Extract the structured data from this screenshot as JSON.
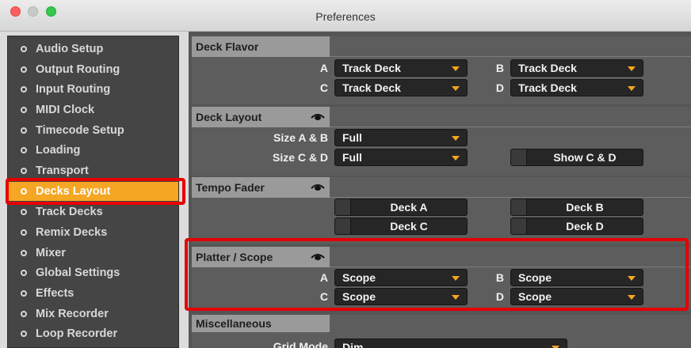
{
  "window": {
    "title": "Preferences"
  },
  "sidebar": {
    "items": [
      {
        "label": "Audio Setup"
      },
      {
        "label": "Output Routing"
      },
      {
        "label": "Input Routing"
      },
      {
        "label": "MIDI Clock"
      },
      {
        "label": "Timecode Setup"
      },
      {
        "label": "Loading"
      },
      {
        "label": "Transport"
      },
      {
        "label": "Decks Layout",
        "selected": true
      },
      {
        "label": "Track Decks"
      },
      {
        "label": "Remix Decks"
      },
      {
        "label": "Mixer"
      },
      {
        "label": "Global Settings"
      },
      {
        "label": "Effects"
      },
      {
        "label": "Mix Recorder"
      },
      {
        "label": "Loop Recorder"
      }
    ]
  },
  "deck_flavor": {
    "title": "Deck Flavor",
    "a_label": "A",
    "a_value": "Track Deck",
    "b_label": "B",
    "b_value": "Track Deck",
    "c_label": "C",
    "c_value": "Track Deck",
    "d_label": "D",
    "d_value": "Track Deck"
  },
  "deck_layout": {
    "title": "Deck Layout",
    "size_ab_label": "Size A & B",
    "size_ab_value": "Full",
    "size_cd_label": "Size C & D",
    "size_cd_value": "Full",
    "show_cd_label": "Show C & D"
  },
  "tempo_fader": {
    "title": "Tempo Fader",
    "deck_a": "Deck A",
    "deck_b": "Deck B",
    "deck_c": "Deck C",
    "deck_d": "Deck D"
  },
  "platter_scope": {
    "title": "Platter / Scope",
    "a_label": "A",
    "a_value": "Scope",
    "b_label": "B",
    "b_value": "Scope",
    "c_label": "C",
    "c_value": "Scope",
    "d_label": "D",
    "d_value": "Scope"
  },
  "miscellaneous": {
    "title": "Miscellaneous",
    "grid_mode_label": "Grid Mode",
    "grid_mode_value": "Dim"
  },
  "colors": {
    "accent": "#f5a623",
    "highlight": "#e50000"
  }
}
